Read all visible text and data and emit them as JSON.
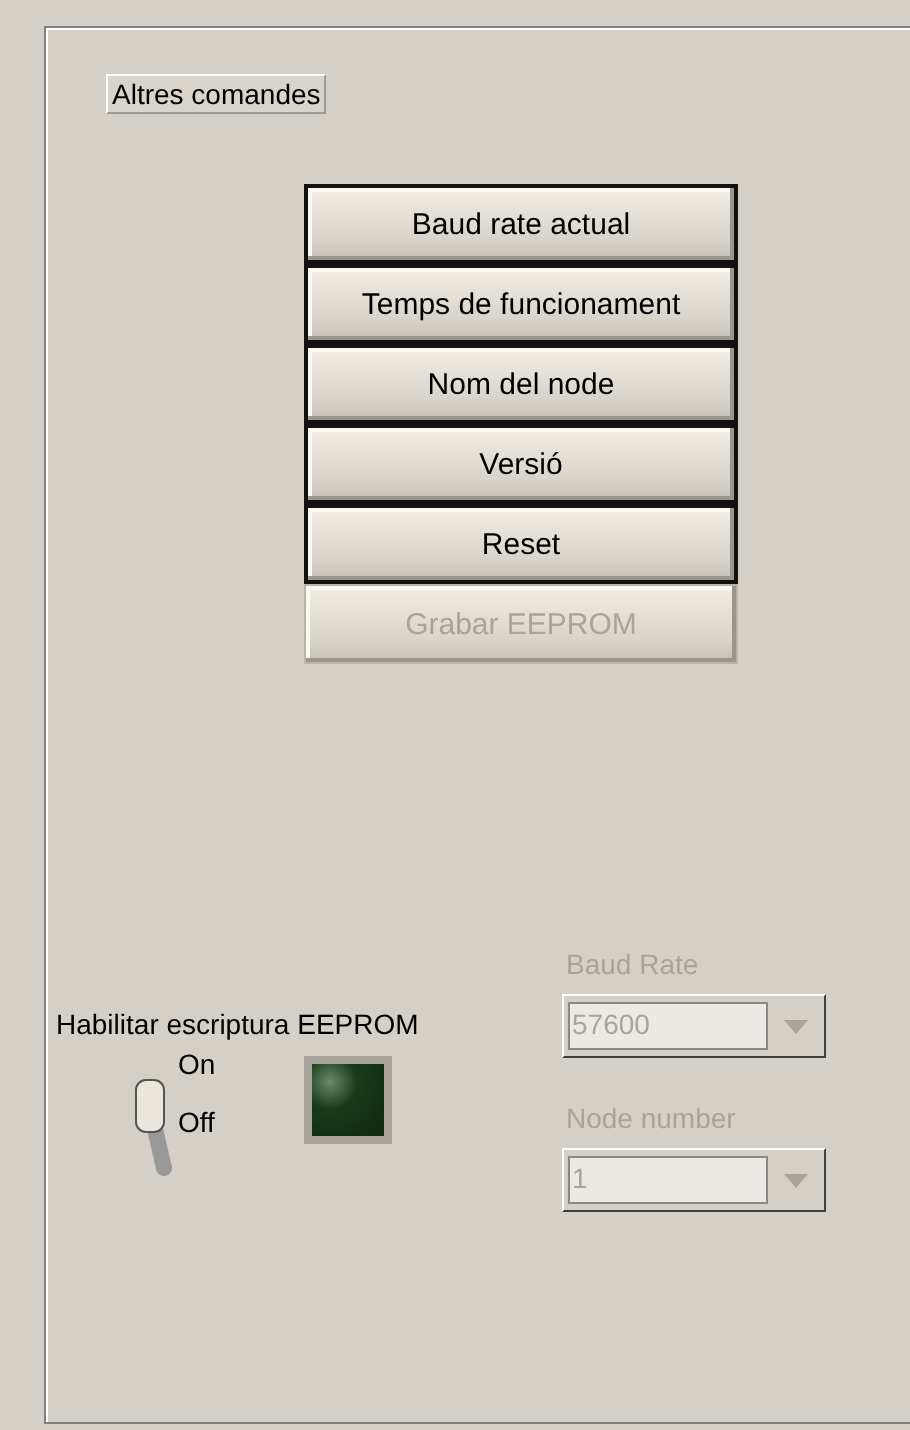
{
  "group_label": "Altres comandes",
  "buttons": [
    {
      "label": "Baud rate actual",
      "disabled": false
    },
    {
      "label": "Temps de funcionament",
      "disabled": false
    },
    {
      "label": "Nom del node",
      "disabled": false
    },
    {
      "label": "Versió",
      "disabled": false
    },
    {
      "label": "Reset",
      "disabled": false
    },
    {
      "label": "Grabar EEPROM",
      "disabled": true
    }
  ],
  "eeprom_write": {
    "label": "Habilitar escriptura EEPROM",
    "on_label": "On",
    "off_label": "Off",
    "on": false
  },
  "led": {
    "on": false
  },
  "baud_rate": {
    "label": "Baud Rate",
    "value": "57600",
    "disabled": true
  },
  "node_number": {
    "label": "Node number",
    "value": "1",
    "disabled": true
  }
}
